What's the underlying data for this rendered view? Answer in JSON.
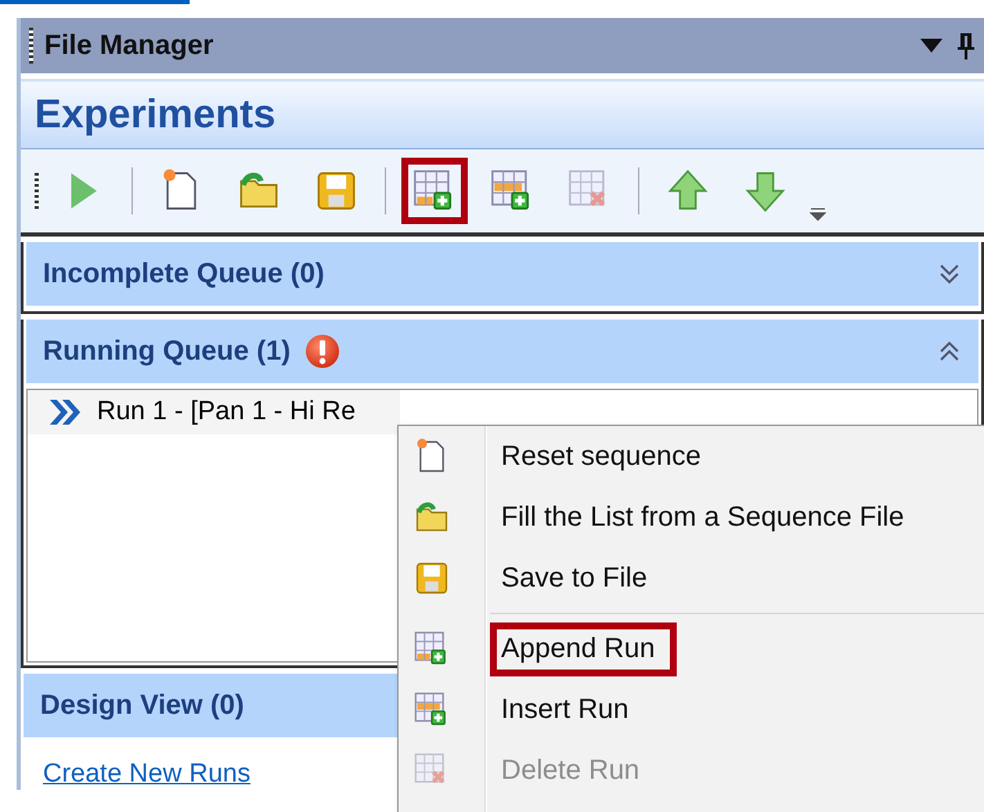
{
  "panel": {
    "title": "File Manager"
  },
  "experiments": {
    "title": "Experiments"
  },
  "toolbar": [
    {
      "kind": "play",
      "disabled": false,
      "highlighted": false
    },
    {
      "kind": "separator"
    },
    {
      "kind": "new",
      "disabled": false,
      "highlighted": false
    },
    {
      "kind": "open",
      "disabled": false,
      "highlighted": false
    },
    {
      "kind": "save",
      "disabled": false,
      "highlighted": false
    },
    {
      "kind": "separator"
    },
    {
      "kind": "append",
      "disabled": false,
      "highlighted": true
    },
    {
      "kind": "insert",
      "disabled": false,
      "highlighted": false
    },
    {
      "kind": "delete",
      "disabled": true,
      "highlighted": false
    },
    {
      "kind": "separator"
    },
    {
      "kind": "up",
      "disabled": false,
      "highlighted": false
    },
    {
      "kind": "down",
      "disabled": false,
      "highlighted": false
    },
    {
      "kind": "overflow"
    }
  ],
  "sections": [
    {
      "title": "Incomplete Queue (0)",
      "expanded": false,
      "warning": false
    },
    {
      "title": "Running Queue (1)",
      "expanded": true,
      "warning": true,
      "rows": [
        {
          "label": "Run 1 - [Pan 1 - Hi Re"
        }
      ]
    },
    {
      "title": "Design View (0)",
      "warning": false,
      "link": "Create New Runs"
    }
  ],
  "context_menu": [
    {
      "kind": "new",
      "label": "Reset sequence",
      "disabled": false,
      "highlighted": false
    },
    {
      "kind": "open",
      "label": "Fill the List from a Sequence File",
      "disabled": false,
      "highlighted": false
    },
    {
      "kind": "save",
      "label": "Save to File",
      "disabled": false,
      "highlighted": false
    },
    {
      "kind": "separator"
    },
    {
      "kind": "append",
      "label": "Append Run",
      "disabled": false,
      "highlighted": true
    },
    {
      "kind": "insert",
      "label": "Insert Run",
      "disabled": false,
      "highlighted": false
    },
    {
      "kind": "delete",
      "label": "Delete Run",
      "disabled": true,
      "highlighted": false
    }
  ]
}
